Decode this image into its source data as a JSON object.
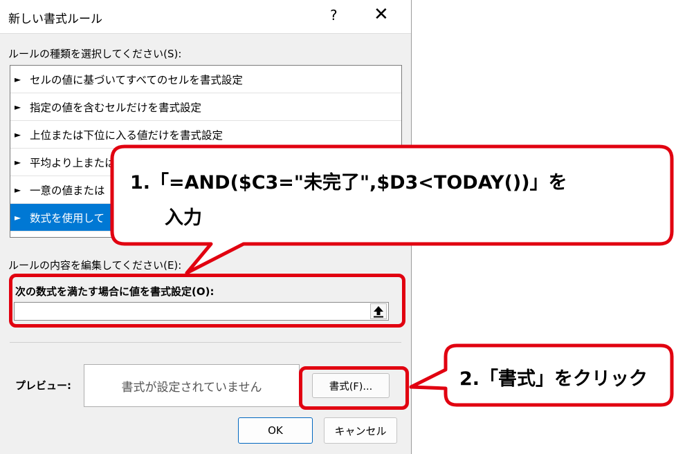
{
  "dialog": {
    "title": "新しい書式ルール",
    "help_label": "?",
    "close_label": "✕",
    "select_type_label": "ルールの種類を選択してください(S):",
    "rule_types": [
      {
        "label": "セルの値に基づいてすべてのセルを書式設定",
        "selected": false
      },
      {
        "label": "指定の値を含むセルだけを書式設定",
        "selected": false
      },
      {
        "label": "上位または下位に入る値だけを書式設定",
        "selected": false
      },
      {
        "label": "平均より上または",
        "selected": false
      },
      {
        "label": "一意の値または",
        "selected": false
      },
      {
        "label": "数式を使用して",
        "selected": true
      }
    ],
    "edit_label": "ルールの内容を編集してください(E):",
    "formula_label": "次の数式を満たす場合に値を書式設定(O):",
    "formula_value": "",
    "preview_label": "プレビュー:",
    "preview_text": "書式が設定されていません",
    "format_button": "書式(F)...",
    "ok_button": "OK",
    "cancel_button": "キャンセル"
  },
  "callouts": {
    "step1_line1": "1.「=AND($C3=\"未完了\",$D3<TODAY())」を",
    "step1_line2": "入力",
    "step2": "2.「書式」をクリック"
  },
  "colors": {
    "accent": "#0078d4",
    "callout_border": "#e10010"
  }
}
